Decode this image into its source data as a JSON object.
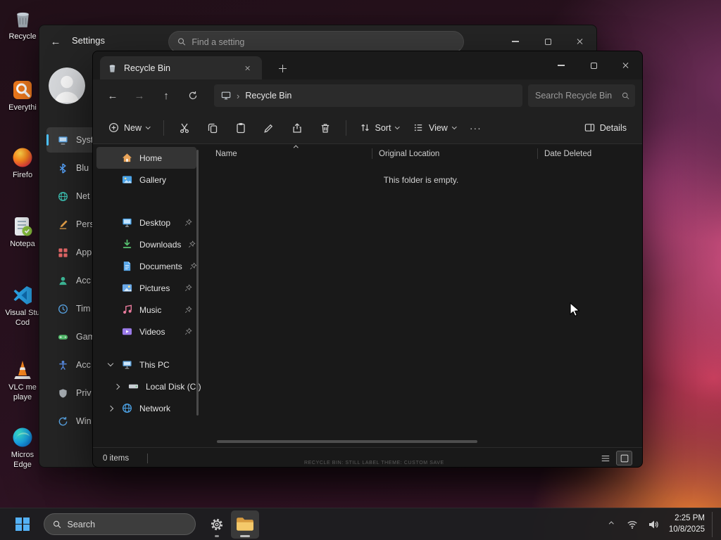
{
  "colors": {
    "accent": "#4cc2ff",
    "selection": "#343434",
    "taskbar_bg": "#1e1e20"
  },
  "wallpaper": {
    "watermark": "RECYCLE BIN: STILL LABEL THEME: CUSTOM SAVE"
  },
  "desktop_icons": [
    {
      "id": "recycle-bin",
      "label": "Recycle"
    },
    {
      "id": "everything",
      "label": "Everythi"
    },
    {
      "id": "firefox",
      "label": "Firefo"
    },
    {
      "id": "notepad-plus-plus",
      "label": "Notepa"
    },
    {
      "id": "visual-studio-code",
      "label": "Visual Stu\nCod"
    },
    {
      "id": "vlc-media-player",
      "label": "VLC me\nplaye"
    },
    {
      "id": "microsoft-edge",
      "label": "Micros\nEdge"
    }
  ],
  "settings_window": {
    "title": "Settings",
    "back_glyph": "←",
    "search_placeholder": "Find a setting",
    "nav_items": [
      {
        "label": "Syst"
      },
      {
        "label": "Blu"
      },
      {
        "label": "Net"
      },
      {
        "label": "Pers"
      },
      {
        "label": "App"
      },
      {
        "label": "Acc"
      },
      {
        "label": "Tim"
      },
      {
        "label": "Gam"
      },
      {
        "label": "Acc"
      },
      {
        "label": "Priv"
      },
      {
        "label": "Win"
      }
    ]
  },
  "explorer": {
    "tab_title": "Recycle Bin",
    "nav_glyphs": {
      "back": "←",
      "forward": "→",
      "up": "↑"
    },
    "breadcrumb": {
      "chevron": "›",
      "path": "Recycle Bin"
    },
    "search_placeholder": "Search Recycle Bin",
    "toolbar": {
      "new": "New",
      "sort": "Sort",
      "view": "View",
      "more": "···",
      "details": "Details"
    },
    "sidebar": {
      "home": "Home",
      "gallery": "Gallery",
      "pinned": [
        "Desktop",
        "Downloads",
        "Documents",
        "Pictures",
        "Music",
        "Videos"
      ],
      "this_pc": "This PC",
      "local_disk": "Local Disk (C:)",
      "network": "Network"
    },
    "columns": [
      "Name",
      "Original Location",
      "Date Deleted"
    ],
    "empty_message": "This folder is empty.",
    "status_items": "0 items"
  },
  "taskbar": {
    "search_placeholder": "Search",
    "clock": {
      "time": "2:25 PM",
      "date": "10/8/2025"
    }
  }
}
